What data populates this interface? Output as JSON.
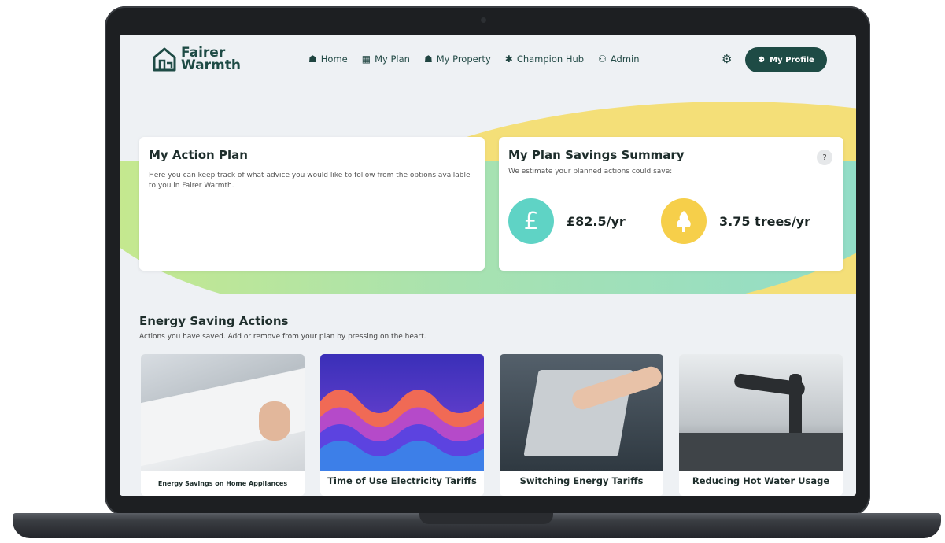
{
  "header": {
    "logo_line1": "Fairer",
    "logo_line2": "Warmth",
    "nav": [
      {
        "label": "Home",
        "icon": "home-icon"
      },
      {
        "label": "My Plan",
        "icon": "calendar-icon"
      },
      {
        "label": "My Property",
        "icon": "house-icon"
      },
      {
        "label": "Champion Hub",
        "icon": "people-icon"
      },
      {
        "label": "Admin",
        "icon": "admin-icon"
      }
    ],
    "profile_label": "My Profile"
  },
  "action_plan": {
    "title": "My Action Plan",
    "description": "Here you can keep track of what advice you would like to follow from the options available to you in Fairer Warmth."
  },
  "savings": {
    "title": "My Plan Savings Summary",
    "subtitle": "We estimate your planned actions could save:",
    "help": "?",
    "money_symbol": "£",
    "money_value": "£82.5/yr",
    "trees_value": "3.75 trees/yr"
  },
  "energy": {
    "title": "Energy Saving Actions",
    "description": "Actions you have saved. Add or remove from your plan by pressing on the heart.",
    "tiles": [
      {
        "label": "Energy Savings on Home Appliances"
      },
      {
        "label": "Time of Use Electricity Tariffs"
      },
      {
        "label": "Switching Energy Tariffs"
      },
      {
        "label": "Reducing Hot Water Usage"
      }
    ]
  },
  "colors": {
    "brand": "#1e4b45",
    "money_circle": "#5fd3c5",
    "trees_circle": "#f6cf4a"
  }
}
